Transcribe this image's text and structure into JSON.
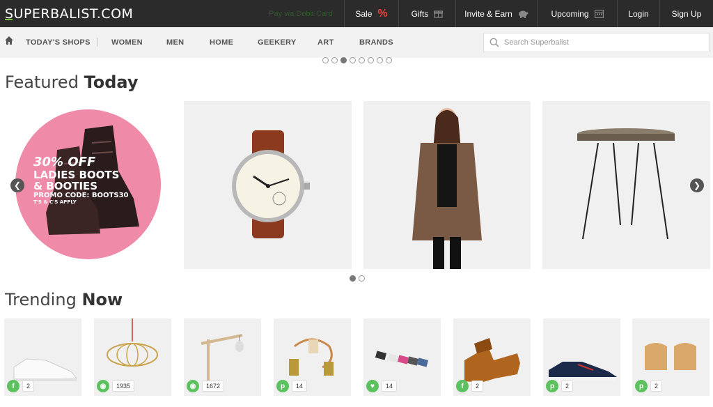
{
  "brand": {
    "logo_text": "SUPERBALIST.COM",
    "accent": "#7ac142"
  },
  "topbar": {
    "promo_text": "Pay via Debit Card",
    "items": [
      {
        "label": "Sale",
        "icon": "percent-icon"
      },
      {
        "label": "Gifts",
        "icon": "gift-icon"
      },
      {
        "label": "Invite & Earn",
        "icon": "piggy-bank-icon"
      },
      {
        "label": "Upcoming",
        "icon": "calendar-icon"
      },
      {
        "label": "Login"
      },
      {
        "label": "Sign Up"
      }
    ]
  },
  "subnav": {
    "items": [
      "TODAY'S SHOPS",
      "WOMEN",
      "MEN",
      "HOME",
      "GEEKERY",
      "ART",
      "BRANDS"
    ],
    "search_placeholder": "Search Superbalist"
  },
  "carousel_top": {
    "count": 8,
    "active": 2
  },
  "featured": {
    "title_light": "Featured",
    "title_bold": "Today",
    "promo": {
      "discount": "30% OFF",
      "line1": "LADIES BOOTS",
      "line2": "& BOOTIES",
      "code": "PROMO CODE: BOOTS30",
      "terms": "T'S & C'S APPLY"
    },
    "products": [
      "watch",
      "jacket",
      "side-table"
    ],
    "pager": {
      "count": 2,
      "active": 0
    }
  },
  "trending": {
    "title_light": "Trending",
    "title_bold": "Now",
    "items": [
      {
        "product": "sneaker",
        "social": "f",
        "count": "2"
      },
      {
        "product": "pendant-lamp",
        "social": "eye",
        "count": "1935"
      },
      {
        "product": "desk-lamp",
        "social": "eye",
        "count": "1672"
      },
      {
        "product": "cord-pendant",
        "social": "p",
        "count": "14"
      },
      {
        "product": "clips",
        "social": "heart",
        "count": "14"
      },
      {
        "product": "wedge-sandal",
        "social": "f",
        "count": "2"
      },
      {
        "product": "navy-sneaker",
        "social": "p",
        "count": "2"
      },
      {
        "product": "wood-blocks",
        "social": "p",
        "count": "2"
      }
    ]
  }
}
